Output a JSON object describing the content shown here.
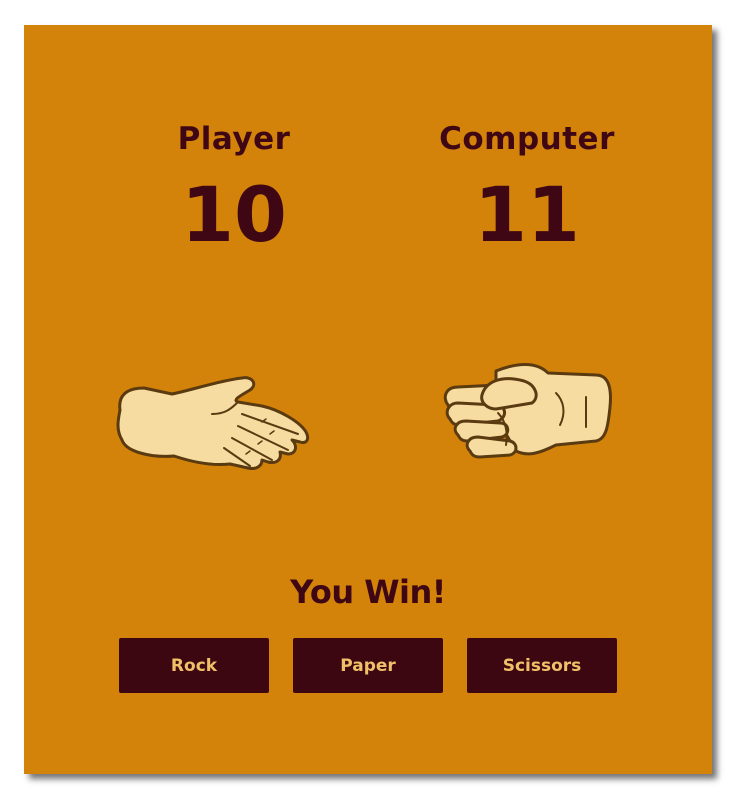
{
  "scoreboard": {
    "player": {
      "label": "Player",
      "score": "10",
      "choice_icon": "paper-hand-icon"
    },
    "computer": {
      "label": "Computer",
      "score": "11",
      "choice_icon": "rock-fist-icon"
    }
  },
  "result": {
    "message": "You Win!"
  },
  "controls": {
    "rock_label": "Rock",
    "paper_label": "Paper",
    "scissors_label": "Scissors"
  },
  "colors": {
    "background": "#d4830a",
    "text": "#3f0713",
    "button_bg": "#3d0711",
    "button_text": "#f0c068",
    "hand_skin": "#f6dca0",
    "hand_outline": "#5a3a10"
  }
}
